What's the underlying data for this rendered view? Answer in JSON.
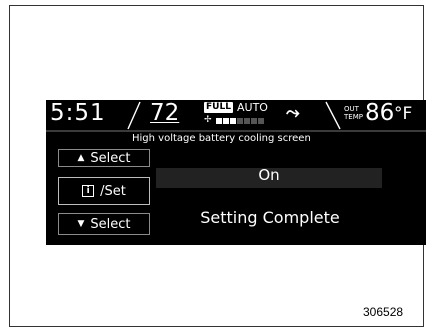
{
  "status_bar": {
    "clock": "5:51",
    "set_temperature": "72",
    "fan_badge": "FULL",
    "mode_label": "AUTO",
    "outside_label_line1": "OUT",
    "outside_label_line2": "TEMP",
    "outside_temperature": "86",
    "outside_unit": "°F",
    "fan_level": 3,
    "fan_segments_total": 7,
    "airflow_icon": "airflow-face-feet-icon"
  },
  "screen": {
    "title": "High voltage battery cooling screen",
    "select_up_label": "Select",
    "info_set_label": "/Set",
    "info_icon_glyph": "i",
    "select_down_label": "Select",
    "setting_value": "On",
    "status_message": "Setting Complete"
  },
  "figure_number": "306528",
  "colors": {
    "screen_background": "#000000",
    "text": "#ffffff",
    "button_border": "#8a8a8a",
    "selected_row": "#222222"
  }
}
